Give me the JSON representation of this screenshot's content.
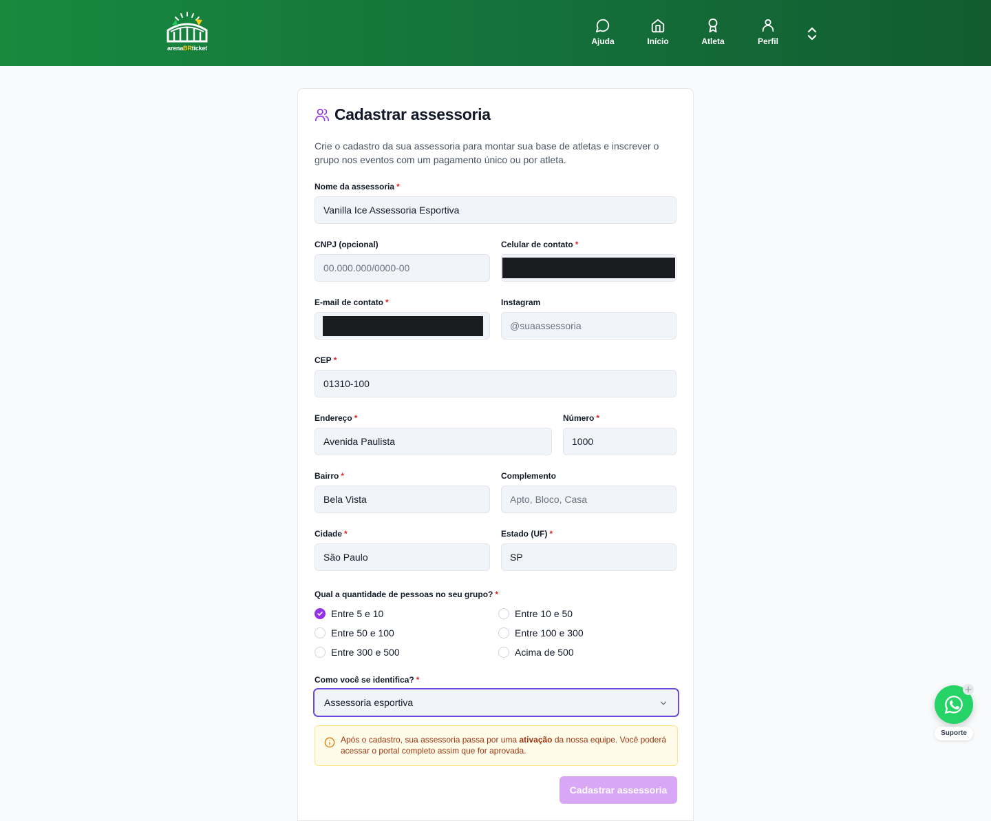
{
  "header": {
    "logo": {
      "text_left": "arena",
      "text_accent": "BR",
      "text_right": "ticket"
    },
    "nav": [
      {
        "label": "Ajuda",
        "icon": "chat-bubble-icon"
      },
      {
        "label": "Início",
        "icon": "home-icon"
      },
      {
        "label": "Atleta",
        "icon": "medal-icon"
      },
      {
        "label": "Perfil",
        "icon": "user-icon"
      }
    ],
    "toggle_icon": "chevrons-up-down-icon"
  },
  "form": {
    "title": "Cadastrar assessoria",
    "title_icon": "users-icon",
    "description": "Crie o cadastro da sua assessoria para montar sua base de atletas e inscrever o grupo nos eventos com um pagamento único ou por atleta.",
    "fields": {
      "nome": {
        "label": "Nome da assessoria",
        "required": "*",
        "value": "Vanilla Ice Assessoria Esportiva"
      },
      "cnpj": {
        "label": "CNPJ (opcional)",
        "placeholder": "00.000.000/0000-00"
      },
      "celular": {
        "label": "Celular de contato",
        "required": "*"
      },
      "email": {
        "label": "E-mail de contato",
        "required": "*"
      },
      "instagram": {
        "label": "Instagram",
        "placeholder": "@suaassessoria"
      },
      "cep": {
        "label": "CEP",
        "required": "*",
        "value": "01310-100"
      },
      "endereco": {
        "label": "Endereço",
        "required": "*",
        "value": "Avenida Paulista"
      },
      "numero": {
        "label": "Número",
        "required": "*",
        "value": "1000"
      },
      "bairro": {
        "label": "Bairro",
        "required": "*",
        "value": "Bela Vista"
      },
      "complemento": {
        "label": "Complemento",
        "placeholder": "Apto, Bloco, Casa"
      },
      "cidade": {
        "label": "Cidade",
        "required": "*",
        "value": "São Paulo"
      },
      "estado": {
        "label": "Estado (UF)",
        "required": "*",
        "value": "SP"
      }
    },
    "group_size": {
      "label": "Qual a quantidade de pessoas no seu grupo?",
      "required": "*",
      "options": [
        "Entre 5 e 10",
        "Entre 10 e 50",
        "Entre 50 e 100",
        "Entre 100 e 300",
        "Entre 300 e 500",
        "Acima de 500"
      ],
      "selected": "Entre 5 e 10"
    },
    "identify": {
      "label": "Como você se identifica?",
      "required": "*",
      "value": "Assessoria esportiva"
    },
    "notice": {
      "before": "Após o cadastro, sua assessoria passa por uma",
      "bold": "ativação",
      "after": "da nossa equipe. Você poderá acessar o portal completo assim que for aprovada."
    },
    "submit_label": "Cadastrar assessoria"
  },
  "support": {
    "label": "Suporte",
    "icon": "whatsapp-icon"
  },
  "colors": {
    "header_green": "#178a3e",
    "accent_purple": "#9333ea",
    "focus_border": "#6d4ae0",
    "submit_disabled": "#d8a8f7",
    "whatsapp_green": "#25d366",
    "required_red": "#dc2626"
  }
}
